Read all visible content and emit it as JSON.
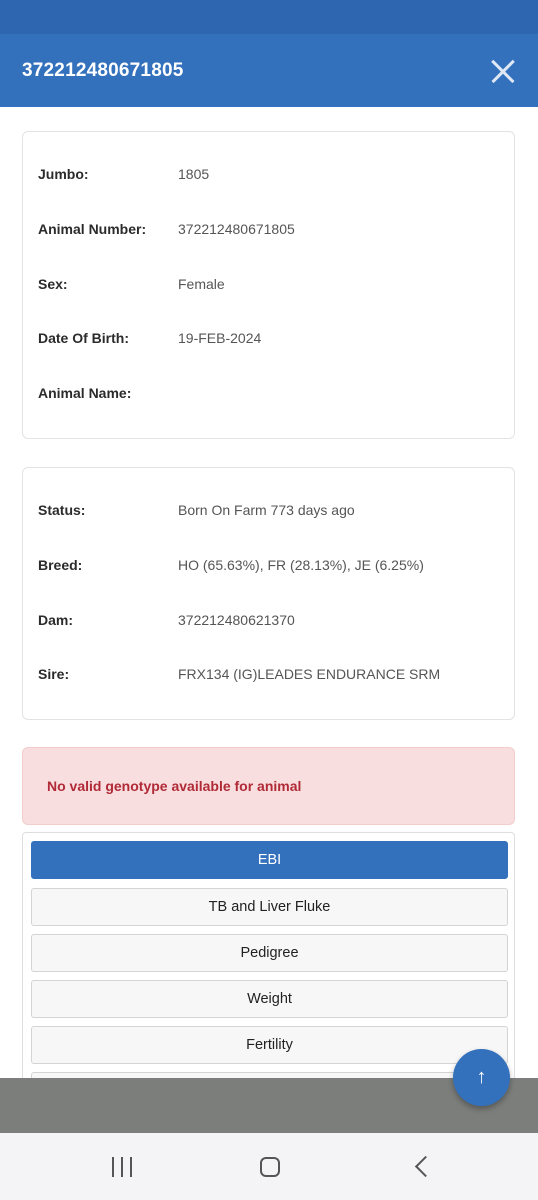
{
  "header": {
    "title": "372212480671805"
  },
  "details": [
    {
      "label": "Jumbo:",
      "value": "1805"
    },
    {
      "label": "Animal Number:",
      "value": "372212480671805"
    },
    {
      "label": "Sex:",
      "value": "Female"
    },
    {
      "label": "Date Of Birth:",
      "value": "19-FEB-2024"
    },
    {
      "label": "Animal Name:",
      "value": ""
    }
  ],
  "info": [
    {
      "label": "Status:",
      "value": "Born On Farm 773 days ago"
    },
    {
      "label": "Breed:",
      "value": "HO (65.63%), FR (28.13%), JE (6.25%)"
    },
    {
      "label": "Dam:",
      "value": "372212480621370"
    },
    {
      "label": "Sire:",
      "value": "FRX134 (IG)LEADES ENDURANCE SRM"
    }
  ],
  "alert": {
    "message": "No valid genotype available for animal"
  },
  "tabs": [
    {
      "label": "EBI",
      "active": true
    },
    {
      "label": "TB and Liver Fluke"
    },
    {
      "label": "Pedigree"
    },
    {
      "label": "Weight"
    },
    {
      "label": "Fertility"
    }
  ],
  "fab": {
    "icon": "arrow-up-icon",
    "glyph": "↑"
  },
  "nav": {
    "recents_icon": "recents-icon",
    "home_icon": "home-icon",
    "back_icon": "back-icon"
  },
  "colors": {
    "primary": "#3471bd",
    "alert_bg": "#f8dede",
    "alert_text": "#b02a37"
  }
}
